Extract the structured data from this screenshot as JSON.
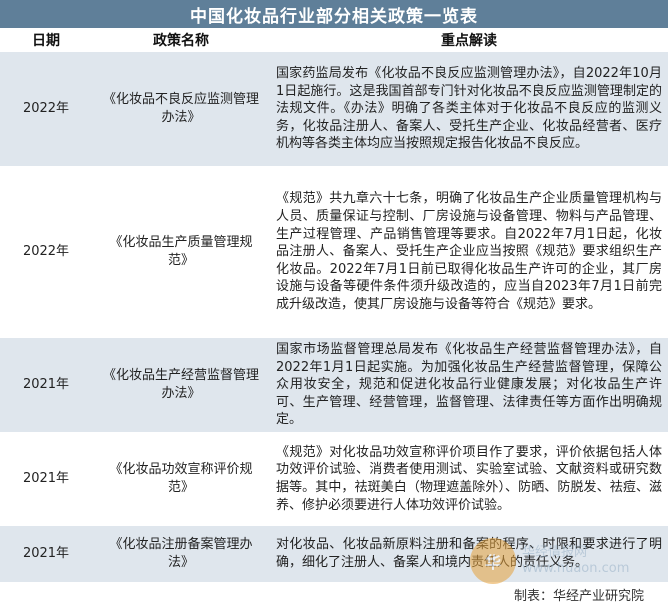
{
  "title": "中国化妆品行业部分相关政策一览表",
  "headers": {
    "date": "日期",
    "name": "政策名称",
    "desc": "重点解读"
  },
  "rows": [
    {
      "date": "2022年",
      "name": "《化妆品不良反应监测管理办法》",
      "desc": "国家药监局发布《化妆品不良反应监测管理办法》，自2022年10月1日起施行。这是我国首部专门针对化妆品不良反应监测管理制定的法规文件。《办法》明确了各类主体对于化妆品不良反应的监测义务，化妆品注册人、备案人、受托生产企业、化妆品经营者、医疗机构等各类主体均应当按照规定报告化妆品不良反应。"
    },
    {
      "date": "2022年",
      "name": "《化妆品生产质量管理规范》",
      "desc": "《规范》共九章六十七条，明确了化妆品生产企业质量管理机构与人员、质量保证与控制、厂房设施与设备管理、物料与产品管理、生产过程管理、产品销售管理等要求。自2022年7月1日起，化妆品注册人、备案人、受托生产企业应当按照《规范》要求组织生产化妆品。2022年7月1日前已取得化妆品生产许可的企业，其厂房设施与设备等硬件条件须升级改造的，应当自2023年7月1日前完成升级改造，使其厂房设施与设备等符合《规范》要求。"
    },
    {
      "date": "2021年",
      "name": "《化妆品生产经营监督管理办法》",
      "desc": "国家市场监督管理总局发布《化妆品生产经营监督管理办法》，自2022年1月1日起实施。为加强化妆品生产经营监督管理，保障公众用妆安全，规范和促进化妆品行业健康发展；对化妆品生产许可、生产管理、经营管理，监督管理、法律责任等方面作出明确规定。"
    },
    {
      "date": "2021年",
      "name": "《化妆品功效宣称评价规范》",
      "desc": "《规范》对化妆品功效宣称评价项目作了要求，评价依据包括人体功效评价试验、消费者使用测试、实验室试验、文献资料或研究数据等。其中，祛斑美白（物理遮盖除外）、防晒、防脱发、祛痘、滋养、修护必须要进行人体功效评价试验。"
    },
    {
      "date": "2021年",
      "name": "《化妆品注册备案管理办法》",
      "desc": "对化妆品、化妆品新原料注册和备案的程序、时限和要求进行了明确，细化了注册人、备案人和境内责任人的责任义务。"
    }
  ],
  "source": "制表：华经产业研究院",
  "watermark": {
    "brand": "华经情报网",
    "url": "www.huaon.com"
  }
}
